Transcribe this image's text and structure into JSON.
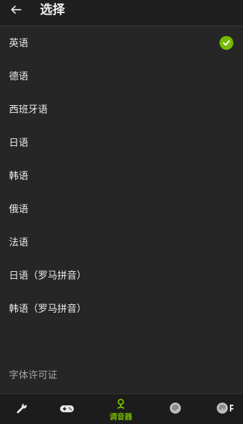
{
  "header": {
    "back_icon": "arrow-left-icon",
    "title": "选择"
  },
  "languages": [
    {
      "label": "英语",
      "selected": true
    },
    {
      "label": "德语",
      "selected": false
    },
    {
      "label": "西班牙语",
      "selected": false
    },
    {
      "label": "日语",
      "selected": false
    },
    {
      "label": "韩语",
      "selected": false
    },
    {
      "label": "俄语",
      "selected": false
    },
    {
      "label": "法语",
      "selected": false
    },
    {
      "label": "日语（罗马拼音）",
      "selected": false
    },
    {
      "label": "韩语（罗马拼音）",
      "selected": false
    }
  ],
  "footer": {
    "license_label": "字体许可证"
  },
  "bottom_nav": {
    "items": [
      {
        "icon": "wrench-icon",
        "label": ""
      },
      {
        "icon": "gamepad-icon",
        "label": ""
      },
      {
        "icon": "tuner-icon",
        "label": "调音器",
        "active": true
      },
      {
        "icon": "fingerprint-icon",
        "label": ""
      },
      {
        "icon": "fingerprint-icon",
        "label": ""
      }
    ]
  },
  "colors": {
    "accent": "#76b900",
    "background": "#262626",
    "header": "#1f1f1f"
  }
}
